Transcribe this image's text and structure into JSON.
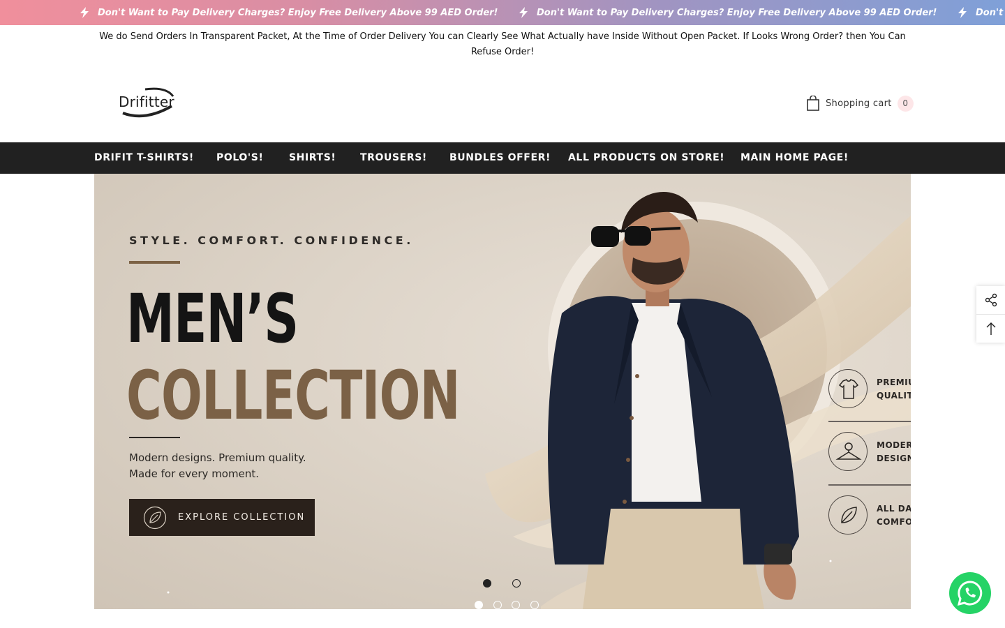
{
  "announcement": {
    "message": "Don't Want to Pay Delivery Charges? Enjoy Free Delivery Above 99 AED Order!",
    "message_truncated": "Don't W"
  },
  "notice": "We do Send Orders In Transparent Packet, At the Time of Order Delivery You can Clearly See What Actually have Inside Without Open Packet. If Looks Wrong Order? then You Can Refuse Order!",
  "header": {
    "logo_text": "Drifitter",
    "cart_label": "Shopping cart",
    "cart_count": "0"
  },
  "nav": {
    "items": [
      "DRIFIT T-SHIRTS!",
      "POLO'S!",
      "SHIRTS!",
      "TROUSERS!",
      "BUNDLES OFFER!",
      "ALL PRODUCTS ON STORE!",
      "MAIN HOME PAGE!"
    ]
  },
  "hero": {
    "tagline": "STYLE. COMFORT. CONFIDENCE.",
    "title_line1": "MEN’S",
    "title_line2": "COLLECTION",
    "subtitle_line1": "Modern designs. Premium quality.",
    "subtitle_line2": "Made for every moment.",
    "cta_label": "EXPLORE COLLECTION",
    "features": [
      {
        "label_line1": "PREMIU",
        "label_line2": "QUALIT",
        "icon": "tshirt-icon"
      },
      {
        "label_line1": "MODERI",
        "label_line2": "DESIGN",
        "icon": "hanger-icon"
      },
      {
        "label_line1": "ALL DAY",
        "label_line2": "COMFO",
        "icon": "leaf-icon"
      }
    ],
    "inner_slide_count": 2,
    "inner_active_index": 0
  },
  "slider": {
    "slide_count": 4,
    "active_index": 0
  },
  "colors": {
    "nav_bg": "#212121",
    "accent_gold": "#7b6146",
    "cta_bg": "#2a211b",
    "whatsapp": "#25d366",
    "cart_badge": "#fde6e8"
  }
}
